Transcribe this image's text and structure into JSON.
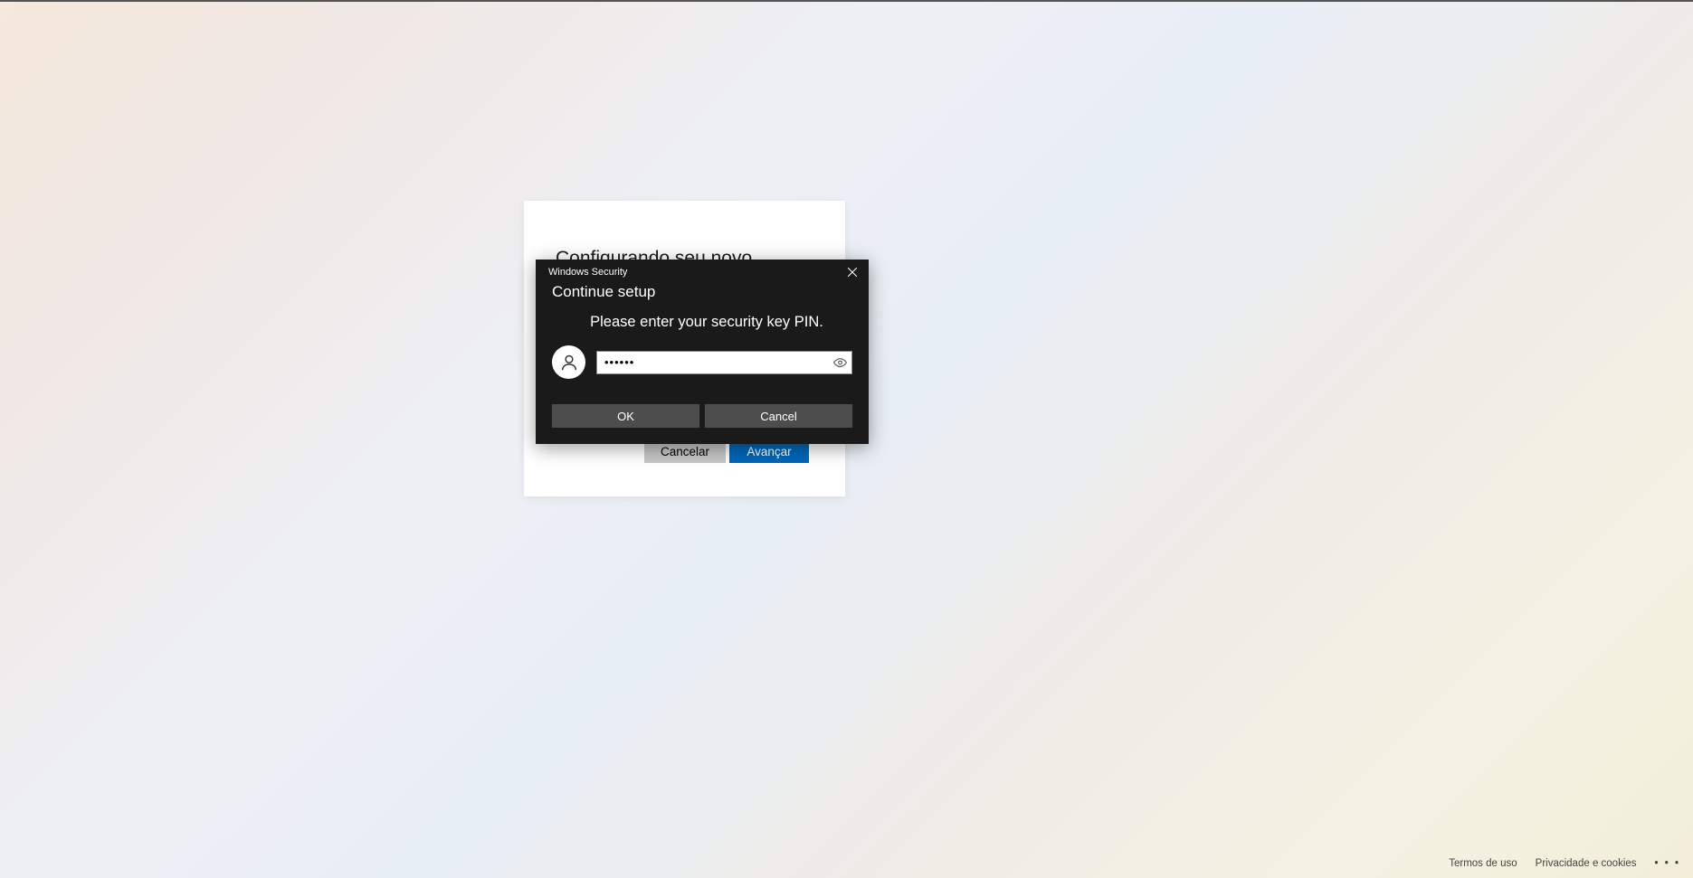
{
  "background_card": {
    "heading": "Configurando seu novo método",
    "cancel": "Cancelar",
    "next": "Avançar"
  },
  "security_dialog": {
    "window_title": "Windows Security",
    "heading": "Continue setup",
    "instruction": "Please enter your security key PIN.",
    "pin_value": "••••••",
    "ok": "OK",
    "cancel": "Cancel"
  },
  "footer": {
    "terms": "Termos de uso",
    "privacy": "Privacidade e cookies",
    "more": "• • •"
  }
}
